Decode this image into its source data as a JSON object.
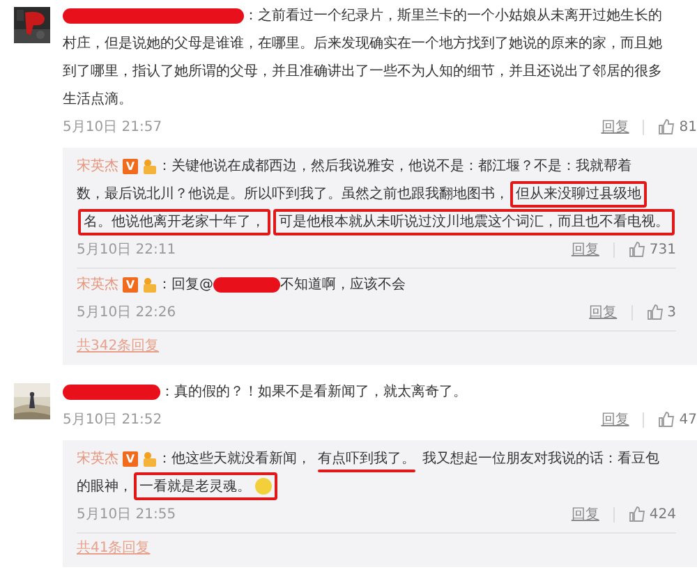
{
  "comments": [
    {
      "avatar": {
        "kind": "picture"
      },
      "author": {
        "redacted": true
      },
      "lines": [
        [
          {
            "kind": "text",
            "text": "：之前看过一个纪录片，斯里兰卡的一个小姑娘从未离开过她生长的"
          }
        ],
        [
          {
            "kind": "text",
            "text": "村庄，但是说她的父母是谁谁，在哪里。后来发现确实在一个地方找到了她说的原来的家，而且她"
          }
        ],
        [
          {
            "kind": "text",
            "text": "到了哪里，指认了她所谓的父母，并且准确讲出了一些不为人知的细节，并且还说出了邻居的很多"
          }
        ],
        [
          {
            "kind": "text",
            "text": "生活点滴。"
          }
        ]
      ],
      "time": "5月10日 21:57",
      "reply_label": "回复",
      "likes": "81",
      "replies": [
        {
          "author": {
            "name": "宋英杰",
            "verified": "V",
            "vip": true
          },
          "lines": [
            [
              {
                "kind": "text",
                "text": "：关键他说在成都西边，然后我说雅安，他说不是：都江堰？不是：我就帮着"
              }
            ],
            [
              {
                "kind": "text",
                "text": "数，最后说北川？他说是。所以吓到我了。虽然之前也跟我翻地图书，"
              },
              {
                "kind": "text",
                "text": "但从来没聊过县级地",
                "boxed": true
              }
            ],
            [
              {
                "kind": "text",
                "text": "名。他说他离开老家十年了，",
                "boxed": true
              },
              {
                "kind": "text",
                "text": "可是他根本就从未听说过汶川地震这个词汇，而且也不看电视。",
                "boxed": true
              }
            ]
          ],
          "time": "5月10日 22:11",
          "reply_label": "回复",
          "likes": "731"
        },
        {
          "author": {
            "name": "宋英杰",
            "verified": "V",
            "vip": true
          },
          "lines": [
            [
              {
                "kind": "text",
                "text": "：回复@"
              },
              {
                "kind": "redaction"
              },
              {
                "kind": "text",
                "text": "不知道啊，应该不会"
              }
            ]
          ],
          "time": "5月10日 22:26",
          "reply_label": "回复",
          "likes": "3"
        }
      ],
      "more_replies": "共342条回复"
    },
    {
      "avatar": {
        "kind": "picture"
      },
      "author": {
        "redacted": true
      },
      "lines": [
        [
          {
            "kind": "text",
            "text": "：真的假的？！如果不是看新闻了，就太离奇了。"
          }
        ]
      ],
      "time": "5月10日 21:52",
      "reply_label": "回复",
      "likes": "47",
      "replies": [
        {
          "author": {
            "name": "宋英杰",
            "verified": "V",
            "vip": true
          },
          "lines": [
            [
              {
                "kind": "text",
                "text": "：他这些天就没看新闻，"
              },
              {
                "kind": "text",
                "text": "有点吓到我了。",
                "underlined": true
              },
              {
                "kind": "text",
                "text": "我又想起一位朋友对我说的话：看豆包"
              }
            ],
            [
              {
                "kind": "text",
                "text": "的眼神，"
              },
              {
                "kind": "text",
                "text": "一看就是老灵魂。",
                "boxed": true
              },
              {
                "kind": "emoji",
                "boxed": true
              }
            ]
          ],
          "time": "5月10日 21:55",
          "reply_label": "回复",
          "likes": "424"
        }
      ],
      "more_replies": "共41条回复"
    }
  ]
}
